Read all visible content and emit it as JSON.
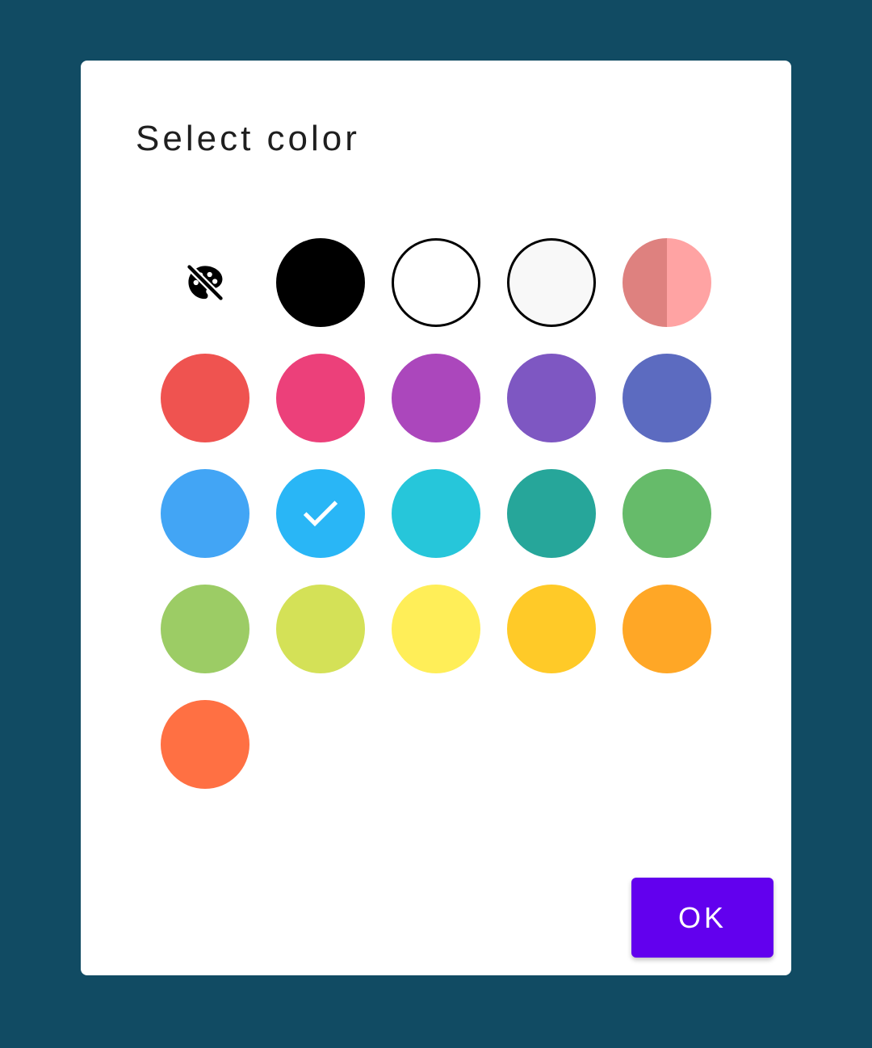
{
  "dialog": {
    "title": "Select color",
    "ok_label": "OK"
  },
  "palette": {
    "selected_index": 11,
    "swatches": [
      {
        "name": "no-color",
        "type": "none",
        "icon": "palette-off-icon"
      },
      {
        "name": "black",
        "color": "#000000"
      },
      {
        "name": "white",
        "color": "#ffffff",
        "outlined": true
      },
      {
        "name": "off-white",
        "color": "#f8f8f8",
        "outlined": true
      },
      {
        "name": "pink-split",
        "color_left": "#de817f",
        "color_right": "#ffa3a3"
      },
      {
        "name": "red",
        "color": "#ef5350"
      },
      {
        "name": "pink",
        "color": "#ec407a"
      },
      {
        "name": "purple",
        "color": "#ab47bc"
      },
      {
        "name": "deep-purple",
        "color": "#7e57c2"
      },
      {
        "name": "indigo",
        "color": "#5c6bc0"
      },
      {
        "name": "blue",
        "color": "#42a5f5"
      },
      {
        "name": "light-blue",
        "color": "#29b6f6"
      },
      {
        "name": "cyan",
        "color": "#26c6da"
      },
      {
        "name": "teal",
        "color": "#26a69a"
      },
      {
        "name": "green",
        "color": "#66bb6a"
      },
      {
        "name": "light-green",
        "color": "#9ccc65"
      },
      {
        "name": "lime",
        "color": "#d4e157"
      },
      {
        "name": "yellow",
        "color": "#ffee58"
      },
      {
        "name": "amber",
        "color": "#ffca28"
      },
      {
        "name": "orange",
        "color": "#ffa726"
      },
      {
        "name": "deep-orange",
        "color": "#ff7043"
      }
    ]
  }
}
